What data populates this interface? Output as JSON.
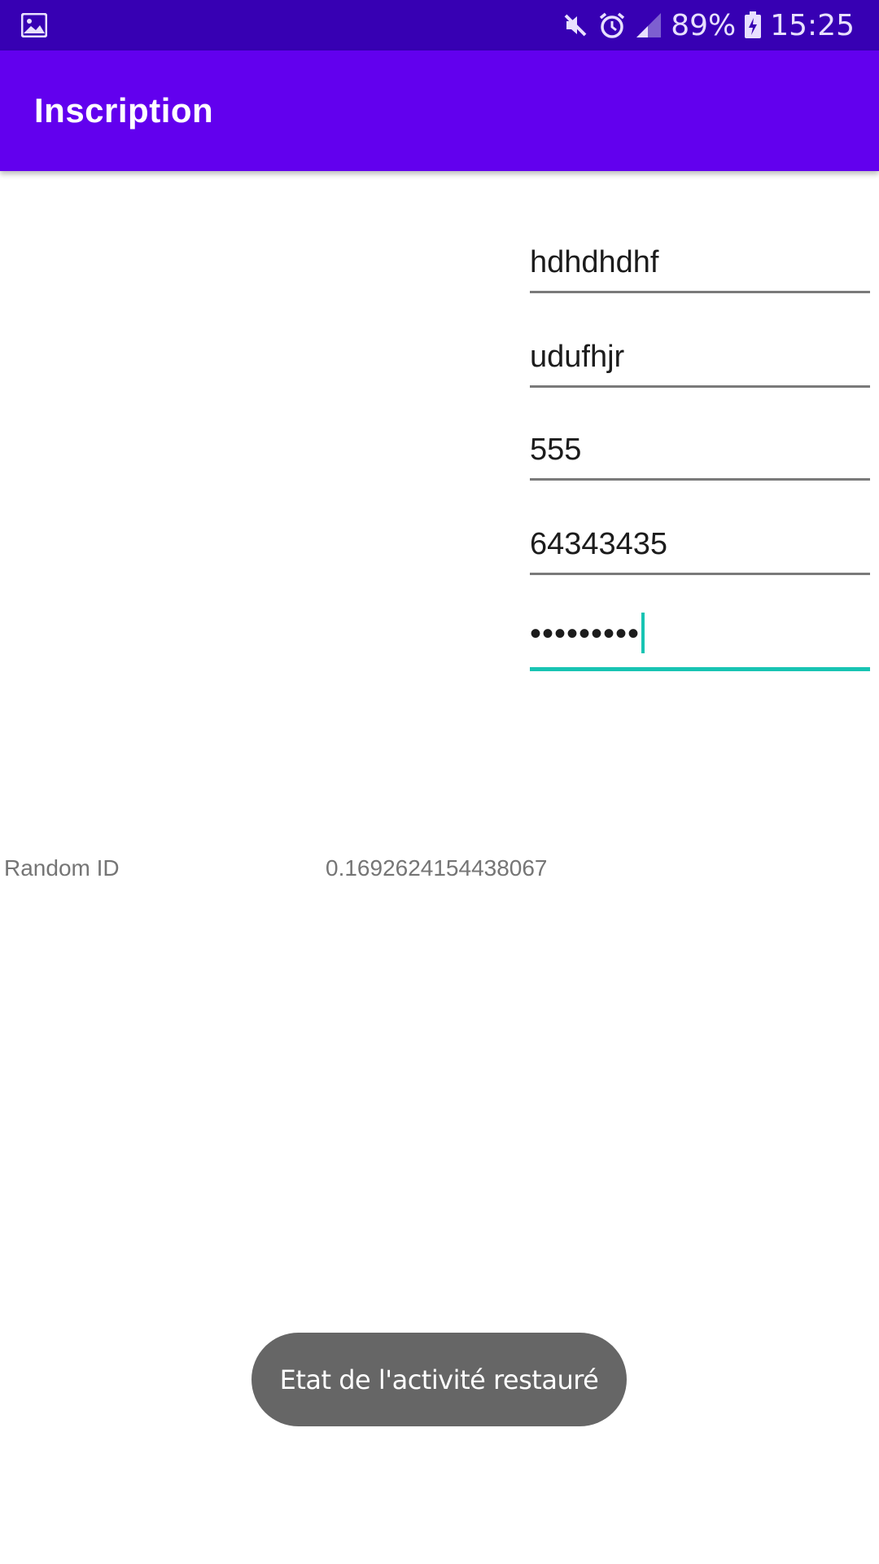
{
  "status_bar": {
    "battery_text": "89%",
    "time": "15:25",
    "icons": [
      "gallery-icon",
      "mute-icon",
      "alarm-icon",
      "signal-icon",
      "battery-charging-icon"
    ]
  },
  "app_bar": {
    "title": "Inscription",
    "color": "#6200ee"
  },
  "form": {
    "fields": [
      {
        "value": "hdhdhdhf"
      },
      {
        "value": "udufhjr"
      },
      {
        "value": "555"
      },
      {
        "value": "64343435"
      },
      {
        "value": "•••••••••"
      }
    ]
  },
  "random_id": {
    "label": "Random ID",
    "value": "0.1692624154438067"
  },
  "toast": {
    "message": "Etat de l'activité restauré"
  },
  "colors": {
    "status_bar": "#3700b3",
    "accent": "#18c4b3"
  }
}
